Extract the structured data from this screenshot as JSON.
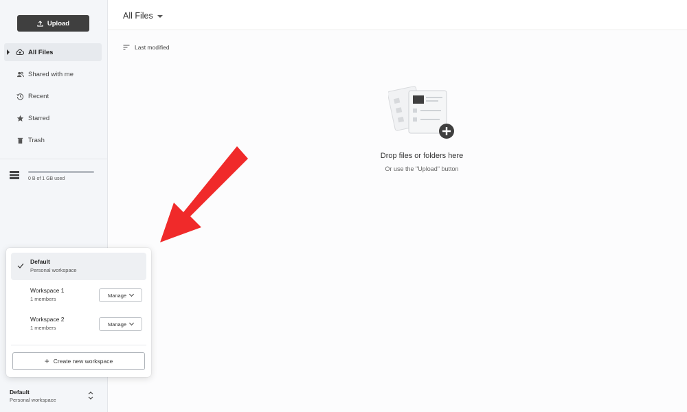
{
  "sidebar": {
    "upload_label": "Upload",
    "nav": [
      {
        "label": "All Files",
        "icon": "cloud-upload-icon",
        "active": true
      },
      {
        "label": "Shared with me",
        "icon": "people-icon",
        "active": false
      },
      {
        "label": "Recent",
        "icon": "history-icon",
        "active": false
      },
      {
        "label": "Starred",
        "icon": "star-icon",
        "active": false
      },
      {
        "label": "Trash",
        "icon": "trash-icon",
        "active": false
      }
    ],
    "storage": {
      "text": "0 B of 1 GB used",
      "used_fraction": 0
    },
    "current_workspace": {
      "name": "Default",
      "subtitle": "Personal workspace"
    }
  },
  "header": {
    "title": "All Files"
  },
  "sort": {
    "label": "Last modified"
  },
  "empty_state": {
    "title": "Drop files or folders here",
    "subtitle": "Or use the \"Upload\" button"
  },
  "workspace_menu": {
    "items": [
      {
        "name": "Default",
        "subtitle": "Personal workspace",
        "selected": true
      },
      {
        "name": "Workspace 1",
        "subtitle": "1 members",
        "manage_label": "Manage"
      },
      {
        "name": "Workspace 2",
        "subtitle": "1 members",
        "manage_label": "Manage"
      }
    ],
    "create_label": "Create new workspace"
  },
  "colors": {
    "accent_dark": "#3f3f3f",
    "sidebar_bg": "#f4f6f9",
    "annotation_arrow": "#f02a2a"
  }
}
